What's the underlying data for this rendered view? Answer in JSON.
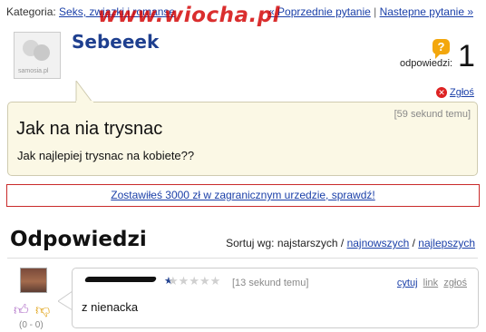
{
  "topbar": {
    "category_label": "Kategoria:",
    "category_link": "Seks, zwiazki i romanse",
    "prev_link": "« Poprzednie pytanie",
    "separator": "|",
    "next_link": "Nastepne pytanie »"
  },
  "watermark": "www.wiocha.pl",
  "avatar_label": "samosia.pl",
  "question": {
    "author": "Sebeeek",
    "answers_label": "odpowiedzi:",
    "answers_count": "1",
    "report_link": "Zgłoś",
    "time": "[59 sekund temu]",
    "title": "Jak na nia trysnac",
    "body": "Jak najlepiej trysnac na kobiete??"
  },
  "promo": {
    "text": "Zostawiłeś 3000 zł w zagranicznym urzedzie, sprawdź!",
    "border_color": "#c92a2a"
  },
  "answers_section": {
    "heading": "Odpowiedzi",
    "sort_label": "Sortuj wg:",
    "sort_current": "najstarszych",
    "sort_newest": "najnowszych",
    "sort_best": "najlepszych",
    "sort_separator": "/"
  },
  "answers": [
    {
      "time": "[13 sekund temu]",
      "quote_link": "cytuj",
      "link_link": "link",
      "report_link": "zgłoś",
      "text": "z nienacka",
      "votes": "(0 - 0)",
      "rating_stars": 5,
      "rating_filled": 0
    }
  ],
  "icons": {
    "question": "question-bubble-icon",
    "report": "report-x-icon",
    "thumb_up": "thumb-up-icon",
    "thumb_down": "thumb-down-icon"
  },
  "colors": {
    "link": "#1a3fa8",
    "username": "#1e3f8f",
    "question_bg": "#fbf8e5",
    "watermark": "#d20000"
  }
}
